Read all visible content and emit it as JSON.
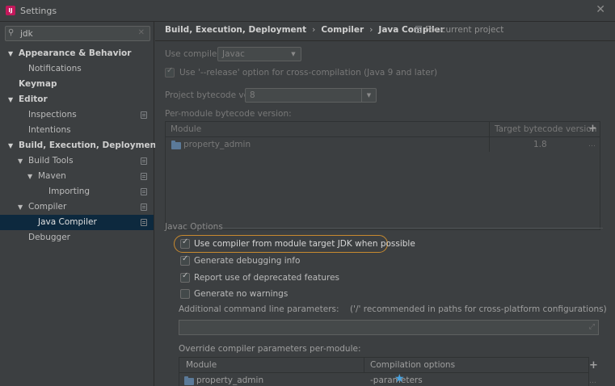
{
  "window": {
    "title": "Settings",
    "app_icon": "intellij-icon"
  },
  "sidebar": {
    "search": {
      "value": "jdk"
    },
    "items": [
      {
        "label": "Appearance & Behavior",
        "expanded": true
      },
      {
        "label": "Notifications"
      },
      {
        "label": "Keymap"
      },
      {
        "label": "Editor",
        "expanded": true
      },
      {
        "label": "Inspections"
      },
      {
        "label": "Intentions"
      },
      {
        "label": "Build, Execution, Deployment",
        "expanded": true
      },
      {
        "label": "Build Tools",
        "expanded": true
      },
      {
        "label": "Maven",
        "expanded": true
      },
      {
        "label": "Importing"
      },
      {
        "label": "Compiler",
        "expanded": true
      },
      {
        "label": "Java Compiler",
        "selected": true
      },
      {
        "label": "Debugger"
      }
    ]
  },
  "header": {
    "breadcrumb": [
      "Build, Execution, Deployment",
      "Compiler",
      "Java Compiler"
    ],
    "separator": "›",
    "scope_note": "For current project"
  },
  "compiler": {
    "use_compiler_label": "Use compiler:",
    "use_compiler_value": "Javac",
    "release_option_label": "Use '--release' option for cross-compilation (Java 9 and later)",
    "release_option_checked": true,
    "project_bytecode_label": "Project bytecode version:",
    "project_bytecode_value": "8",
    "per_module_label": "Per-module bytecode version:",
    "module_table": {
      "columns": [
        "Module",
        "Target bytecode version"
      ],
      "rows": [
        {
          "module": "property_admin",
          "target": "1.8"
        }
      ]
    }
  },
  "javac": {
    "section_title": "Javac Options",
    "options": [
      {
        "label": "Use compiler from module target JDK when possible",
        "checked": true
      },
      {
        "label": "Generate debugging info",
        "checked": true
      },
      {
        "label": "Report use of deprecated features",
        "checked": true
      },
      {
        "label": "Generate no warnings",
        "checked": false
      }
    ],
    "additional_params_label": "Additional command line parameters:",
    "additional_params_hint": "('/' recommended in paths for cross-platform configurations)",
    "additional_params_value": "",
    "override_label": "Override compiler parameters per-module:",
    "override_table": {
      "columns": [
        "Module",
        "Compilation options"
      ],
      "rows": [
        {
          "module": "property_admin",
          "options": "-parameters"
        }
      ]
    }
  },
  "colors": {
    "background": "#3c3f41",
    "selection": "#0d293e",
    "highlight_ring": "#c88a2f"
  }
}
